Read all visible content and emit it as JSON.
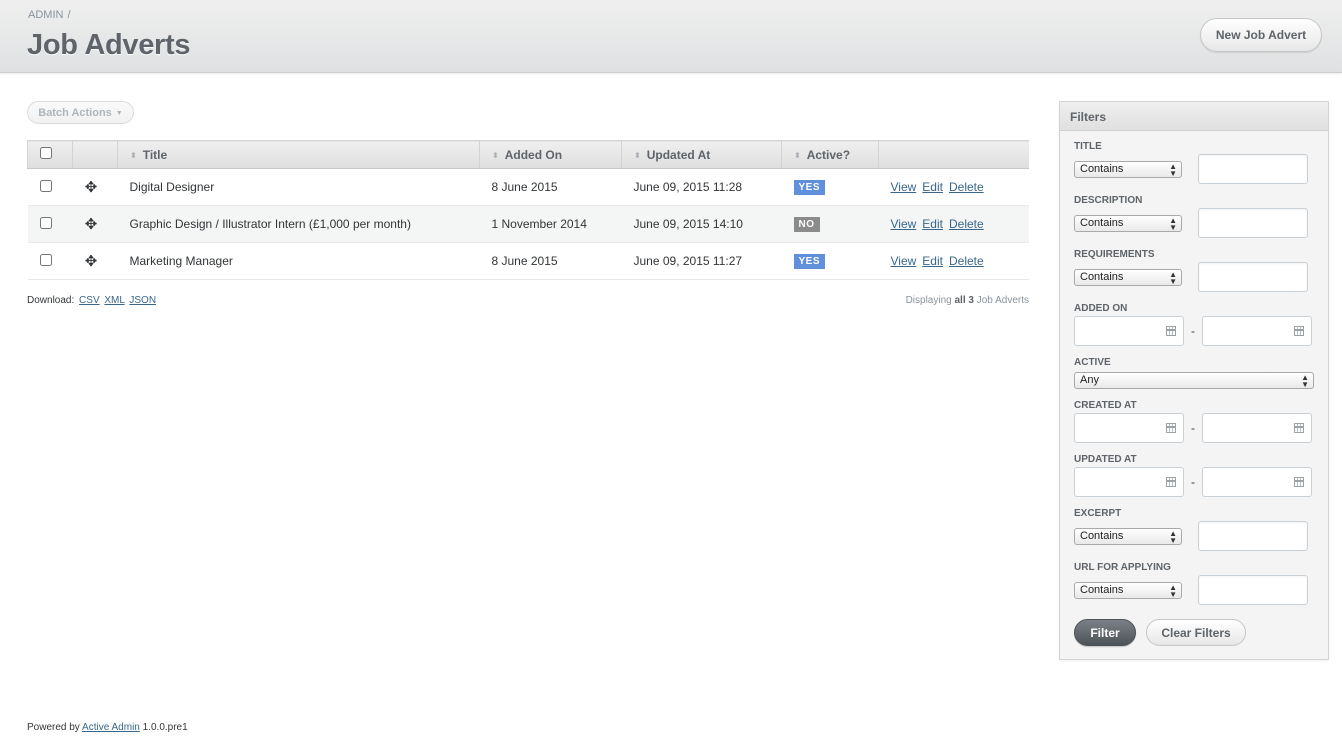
{
  "header": {
    "breadcrumb": "ADMIN",
    "breadcrumb_sep": "/",
    "title": "Job Adverts",
    "action_label": "New Job Advert"
  },
  "batch_actions": {
    "label": "Batch Actions"
  },
  "table": {
    "columns": [
      "Title",
      "Added On",
      "Updated At",
      "Active?"
    ],
    "rows": [
      {
        "title": "Digital Designer",
        "added_on": "8 June 2015",
        "updated_at": "June 09, 2015 11:28",
        "active": "YES"
      },
      {
        "title": "Graphic Design / Illustrator Intern (£1,000 per month)",
        "added_on": "1 November 2014",
        "updated_at": "June 09, 2015 14:10",
        "active": "NO"
      },
      {
        "title": "Marketing Manager",
        "added_on": "8 June 2015",
        "updated_at": "June 09, 2015 11:27",
        "active": "YES"
      }
    ],
    "row_actions": {
      "view": "View",
      "edit": "Edit",
      "delete": "Delete"
    }
  },
  "download": {
    "label": "Download:",
    "formats": [
      "CSV",
      "XML",
      "JSON"
    ]
  },
  "pagination_info": {
    "prefix": "Displaying",
    "all": "all 3",
    "suffix": "Job Adverts"
  },
  "sidebar": {
    "title": "Filters",
    "filters": {
      "title_label": "Title",
      "description_label": "Description",
      "requirements_label": "Requirements",
      "added_on_label": "Added On",
      "active_label": "Active",
      "created_at_label": "Created At",
      "updated_at_label": "Updated At",
      "excerpt_label": "Excerpt",
      "url_label": "URL for applying",
      "contains_option": "Contains",
      "any_option": "Any",
      "range_dash": "-"
    },
    "filter_button": "Filter",
    "clear_button": "Clear Filters"
  },
  "footer": {
    "prefix": "Powered by",
    "link": "Active Admin",
    "version": "1.0.0.pre1"
  },
  "colors": {
    "status_yes": "#6090db",
    "status_no": "#8b8b8b",
    "link": "#38678b"
  }
}
